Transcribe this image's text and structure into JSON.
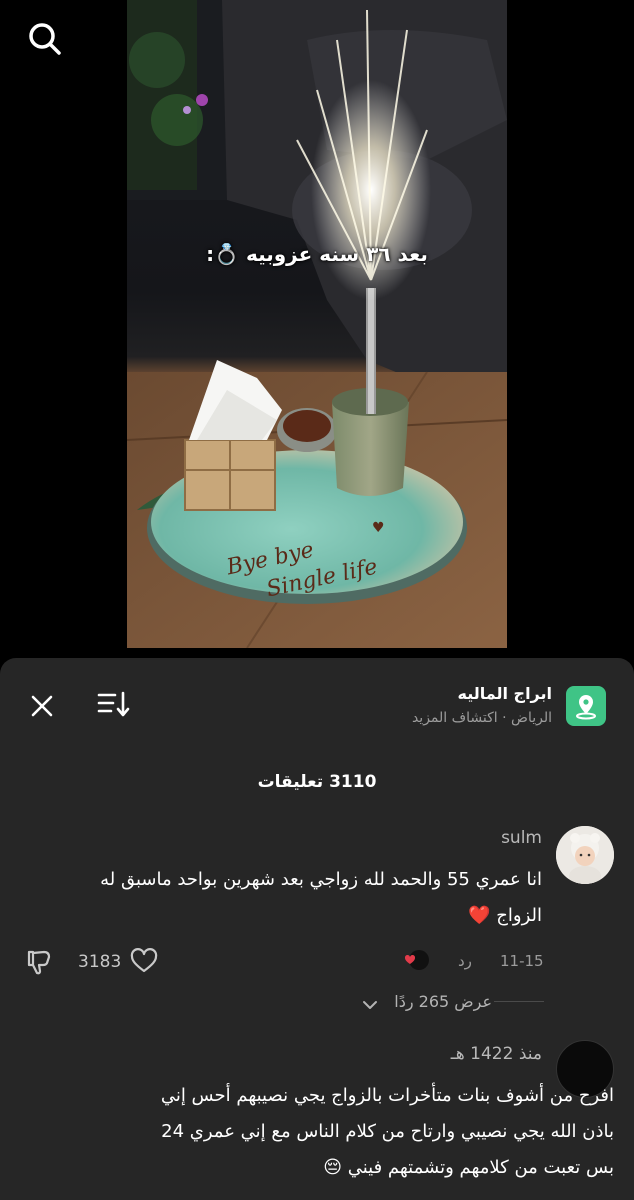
{
  "video": {
    "caption": "بعد ٣٦ سنه عزوبيه 💍:",
    "plate_text": "Bye bye Single life"
  },
  "sheet": {
    "place_name": "ابراج الماليه",
    "place_sub": "الرياض · اكتشاف المزيد",
    "comments_count": "3110 تعليقات"
  },
  "comments": [
    {
      "username": "sulm",
      "text_line1": "انا عمري 55 والحمد لله زواجي بعد شهرين بواحد ماسبق له",
      "text_line2": "الزواج ❤️",
      "date": "11-15",
      "reply_label": "رد",
      "likes": "3183",
      "view_replies": "عرض 265 ردًا"
    },
    {
      "username": "منذ 1422 هـ",
      "text_line1": "افرح من أشوف بنات متأخرات بالزواج يجي نصيبهم أحس إني",
      "text_line2": "باذن الله يجي نصيبي وارتاح من كلام الناس مع إني عمري 24",
      "text_line3": "بس تعبت من كلامهم وتشمتهم فيني 😔"
    }
  ],
  "icons": {
    "search": "search-icon",
    "close": "close-icon",
    "sort": "sort-icon",
    "place": "map-pin-icon",
    "like": "heart-outline-icon",
    "dislike": "thumbs-down-icon"
  },
  "colors": {
    "sheet_bg": "#262626",
    "place_icon": "#3fc486",
    "heart": "#e23b4a",
    "muted_text": "#9c9c9c"
  }
}
